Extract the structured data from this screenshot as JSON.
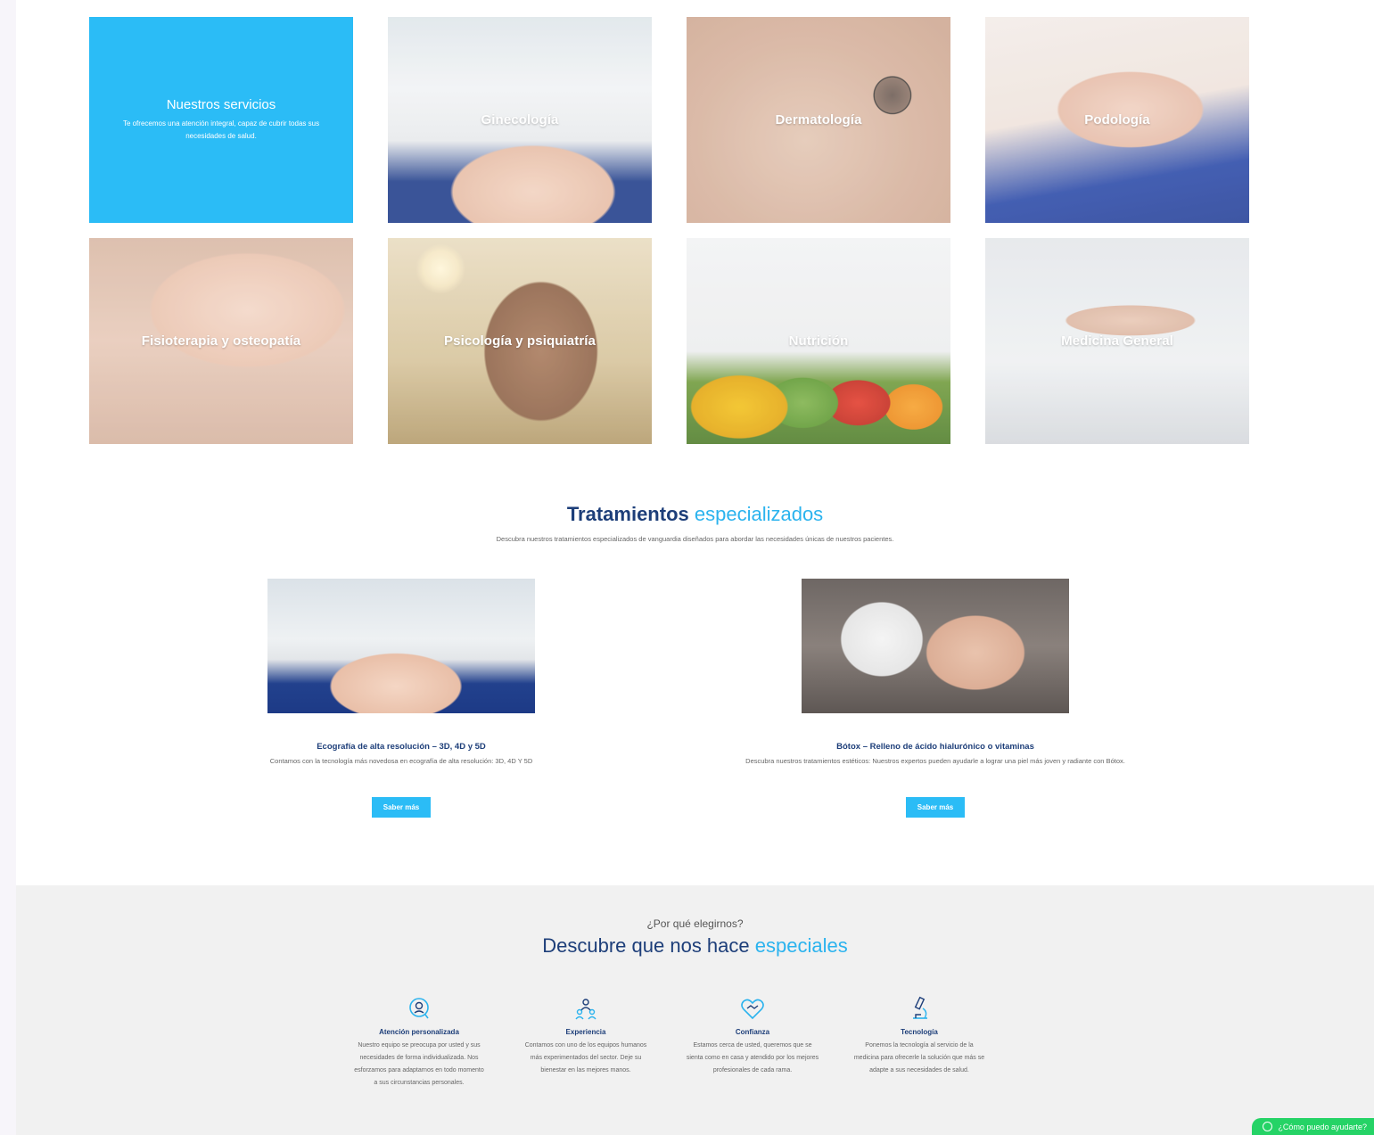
{
  "services": {
    "intro_title": "Nuestros servicios",
    "intro_text": "Te ofrecemos una atención integral, capaz de cubrir todas sus necesidades de salud.",
    "tiles": [
      {
        "label": "Ginecología"
      },
      {
        "label": "Dermatología"
      },
      {
        "label": "Podología"
      },
      {
        "label": "Fisioterapia y osteopatía"
      },
      {
        "label": "Psicología y psiquiatría"
      },
      {
        "label": "Nutrición"
      },
      {
        "label": "Medicina General"
      }
    ]
  },
  "treatments": {
    "title_main": "Tratamientos",
    "title_accent": "especializados",
    "subtitle": "Descubra nuestros tratamientos especializados de vanguardia diseñados para abordar las necesidades únicas de nuestros pacientes.",
    "items": [
      {
        "title": "Ecografía de alta resolución – 3D, 4D y 5D",
        "desc": "Contamos con la tecnología más novedosa en ecografía de alta resolución: 3D, 4D Y 5D",
        "button": "Saber más"
      },
      {
        "title": "Bótox – Relleno de ácido hialurónico o vitaminas",
        "desc": "Descubra nuestros tratamientos estéticos: Nuestros expertos pueden ayudarle a lograr una piel más joven y radiante con Bótox.",
        "button": "Saber más"
      }
    ]
  },
  "why": {
    "kicker": "¿Por qué elegirnos?",
    "title_main": "Descubre que nos hace",
    "title_accent": "especiales",
    "features": [
      {
        "icon": "headset-icon",
        "title": "Atención personalizada",
        "desc": "Nuestro equipo se preocupa por usted y sus necesidades de forma individualizada. Nos esforzamos para adaptarnos en todo momento a sus circunstancias personales."
      },
      {
        "icon": "team-icon",
        "title": "Experiencia",
        "desc": "Contamos con uno de los equipos humanos más experimentados del sector. Deje su bienestar en las mejores manos."
      },
      {
        "icon": "heart-handshake-icon",
        "title": "Confianza",
        "desc": "Estamos cerca de usted, queremos que se sienta como en casa y atendido por los mejores profesionales de cada rama."
      },
      {
        "icon": "microscope-icon",
        "title": "Tecnología",
        "desc": "Ponemos la tecnología al servicio de la medicina para ofrecerle la solución que más se adapte a sus necesidades de salud."
      }
    ]
  },
  "whatsapp": {
    "label": "¿Cómo puedo ayudarte?"
  },
  "colors": {
    "accent": "#2bbcf6",
    "navy": "#1d3e79",
    "whatsapp": "#25d366"
  }
}
